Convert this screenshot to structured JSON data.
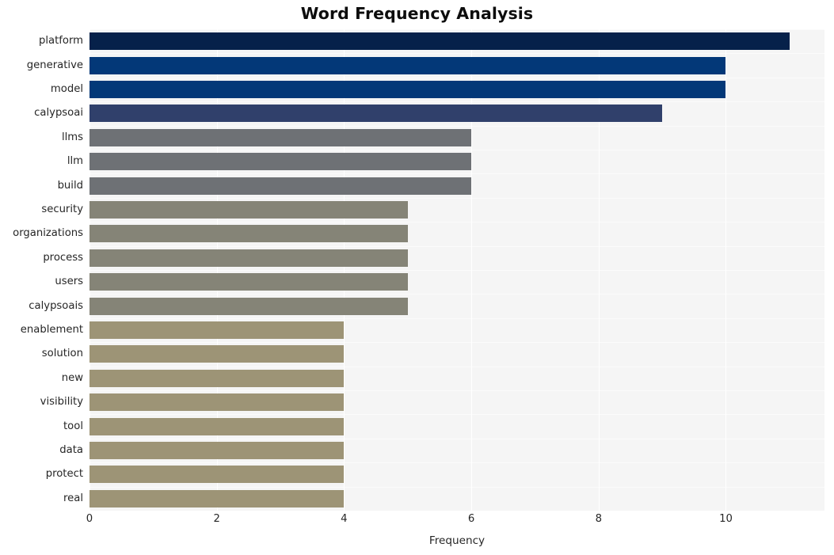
{
  "chart_data": {
    "type": "bar",
    "orientation": "horizontal",
    "title": "Word Frequency Analysis",
    "xlabel": "Frequency",
    "ylabel": "",
    "xlim": [
      0,
      11.55
    ],
    "xticks": [
      0,
      2,
      4,
      6,
      8,
      10
    ],
    "xtick_labels": [
      "0",
      "2",
      "4",
      "6",
      "8",
      "10"
    ],
    "grid": true,
    "grid_axis": "both",
    "legend": null,
    "plot_background": "#f5f5f5",
    "figure_background": "#ffffff",
    "categories": [
      "platform",
      "generative",
      "model",
      "calypsoai",
      "llms",
      "llm",
      "build",
      "security",
      "organizations",
      "process",
      "users",
      "calypsoais",
      "enablement",
      "solution",
      "new",
      "visibility",
      "tool",
      "data",
      "protect",
      "real"
    ],
    "values": [
      11,
      10,
      10,
      9,
      6,
      6,
      6,
      5,
      5,
      5,
      5,
      5,
      4,
      4,
      4,
      4,
      4,
      4,
      4,
      4
    ],
    "bar_colors": [
      "#06214a",
      "#033878",
      "#033878",
      "#30406b",
      "#6e7175",
      "#6e7175",
      "#6e7175",
      "#858477",
      "#858477",
      "#858477",
      "#858477",
      "#858477",
      "#9d9476",
      "#9d9476",
      "#9d9476",
      "#9d9476",
      "#9d9476",
      "#9d9476",
      "#9d9476",
      "#9d9476"
    ]
  }
}
